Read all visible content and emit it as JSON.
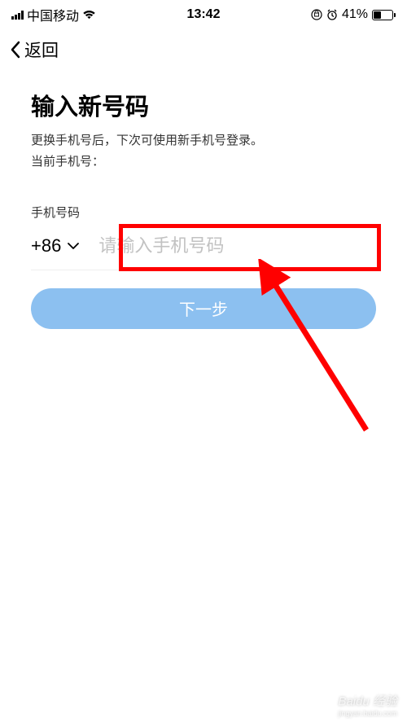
{
  "status_bar": {
    "carrier": "中国移动",
    "time": "13:42",
    "battery_percent": "41%"
  },
  "nav": {
    "back_label": "返回"
  },
  "page": {
    "title": "输入新号码",
    "subtitle": "更换手机号后，下次可使用新手机号登录。",
    "current_phone_label": "当前手机号：",
    "field_label": "手机号码",
    "country_code": "+86",
    "input_placeholder": "请输入手机号码",
    "next_button": "下一步"
  },
  "annotation": {
    "highlight_color": "#ff0000"
  },
  "watermark": {
    "brand": "Baidu 经验",
    "url": "jingyan.baidu.com"
  }
}
